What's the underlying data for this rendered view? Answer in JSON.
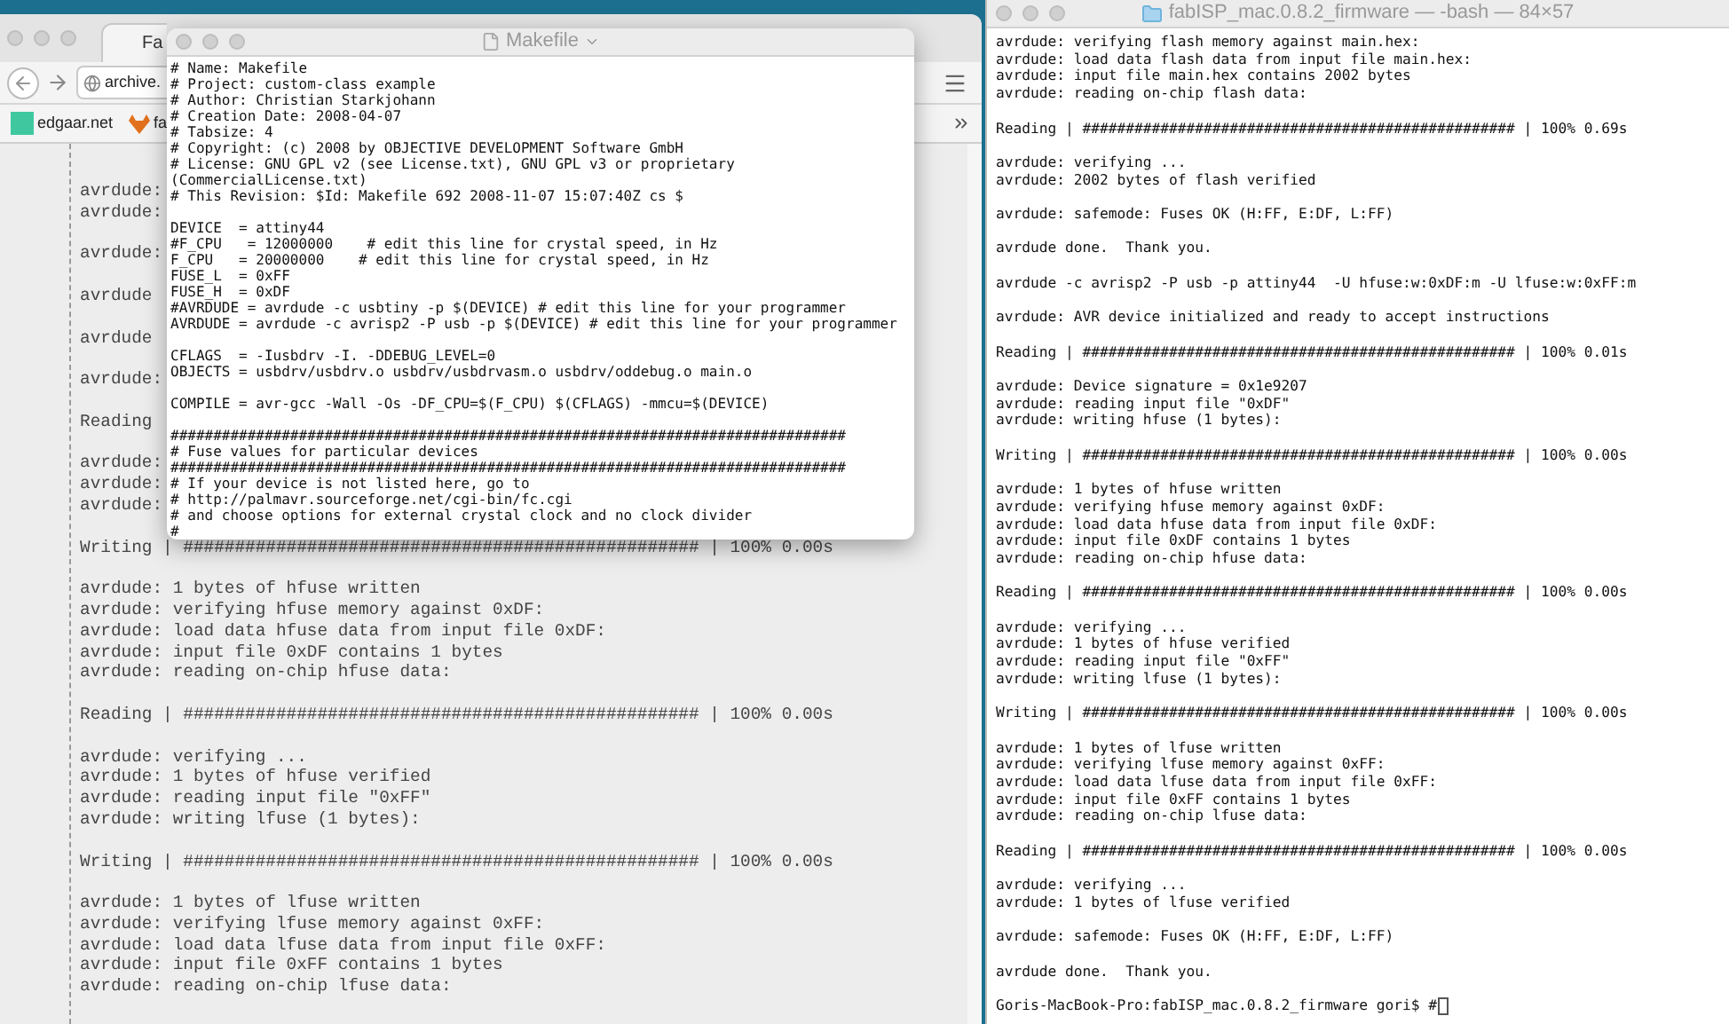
{
  "browser": {
    "tab": {
      "title": "Fa"
    },
    "address_bar": {
      "value": "archive."
    },
    "bookmarks": [
      {
        "label": "edgaar.net",
        "kind": "square"
      },
      {
        "label": "fa",
        "kind": "fox"
      }
    ],
    "page": {
      "output_blocks": [
        [
          "avrdude:",
          "avrdude:"
        ],
        [
          "avrdude:"
        ],
        [
          "avrdude"
        ],
        [
          "avrdude"
        ],
        [
          "avrdude:"
        ],
        [
          "Reading"
        ],
        [
          "avrdude:",
          "avrdude:",
          "avrdude:"
        ],
        [
          "Writing | ################################################## | 100% 0.00s"
        ],
        [
          "avrdude: 1 bytes of hfuse written",
          "avrdude: verifying hfuse memory against 0xDF:",
          "avrdude: load data hfuse data from input file 0xDF:",
          "avrdude: input file 0xDF contains 1 bytes",
          "avrdude: reading on-chip hfuse data:"
        ],
        [
          "Reading | ################################################## | 100% 0.00s"
        ],
        [
          "avrdude: verifying ...",
          "avrdude: 1 bytes of hfuse verified",
          "avrdude: reading input file \"0xFF\"",
          "avrdude: writing lfuse (1 bytes):"
        ],
        [
          "Writing | ################################################## | 100% 0.00s"
        ],
        [
          "avrdude: 1 bytes of lfuse written",
          "avrdude: verifying lfuse memory against 0xFF:",
          "avrdude: load data lfuse data from input file 0xFF:",
          "avrdude: input file 0xFF contains 1 bytes",
          "avrdude: reading on-chip lfuse data:"
        ]
      ]
    }
  },
  "editor": {
    "title": "Makefile",
    "blocks": [
      [
        "# Name: Makefile",
        "# Project: custom-class example",
        "# Author: Christian Starkjohann",
        "# Creation Date: 2008-04-07",
        "# Tabsize: 4",
        "# Copyright: (c) 2008 by OBJECTIVE DEVELOPMENT Software GmbH",
        "# License: GNU GPL v2 (see License.txt), GNU GPL v3 or proprietary",
        "(CommercialLicense.txt)",
        "# This Revision: $Id: Makefile 692 2008-11-07 15:07:40Z cs $"
      ],
      [
        "DEVICE  = attiny44",
        "#F_CPU   = 12000000    # edit this line for crystal speed, in Hz",
        "F_CPU   = 20000000    # edit this line for crystal speed, in Hz",
        "FUSE_L  = 0xFF",
        "FUSE_H  = 0xDF",
        "#AVRDUDE = avrdude -c usbtiny -p $(DEVICE) # edit this line for your programmer",
        "AVRDUDE = avrdude -c avrisp2 -P usb -p $(DEVICE) # edit this line for your programmer"
      ],
      [
        "CFLAGS  = -Iusbdrv -I. -DDEBUG_LEVEL=0",
        "OBJECTS = usbdrv/usbdrv.o usbdrv/usbdrvasm.o usbdrv/oddebug.o main.o"
      ],
      [
        "COMPILE = avr-gcc -Wall -Os -DF_CPU=$(F_CPU) $(CFLAGS) -mmcu=$(DEVICE)"
      ],
      [
        "###############################################################################",
        "# Fuse values for particular devices",
        "###############################################################################",
        "# If your device is not listed here, go to",
        "# http://palmavr.sourceforge.net/cgi-bin/fc.cgi",
        "# and choose options for external crystal clock and no clock divider",
        "#"
      ]
    ]
  },
  "terminal": {
    "title": "fabISP_mac.0.8.2_firmware — -bash — 84×57",
    "blocks": [
      [
        "avrdude: verifying flash memory against main.hex:",
        "avrdude: load data flash data from input file main.hex:",
        "avrdude: input file main.hex contains 2002 bytes",
        "avrdude: reading on-chip flash data:"
      ],
      [
        "Reading | ################################################## | 100% 0.69s"
      ],
      [
        "avrdude: verifying ...",
        "avrdude: 2002 bytes of flash verified"
      ],
      [
        "avrdude: safemode: Fuses OK (H:FF, E:DF, L:FF)"
      ],
      [
        "avrdude done.  Thank you."
      ],
      [
        "avrdude -c avrisp2 -P usb -p attiny44  -U hfuse:w:0xDF:m -U lfuse:w:0xFF:m"
      ],
      [
        "avrdude: AVR device initialized and ready to accept instructions"
      ],
      [
        "Reading | ################################################## | 100% 0.01s"
      ],
      [
        "avrdude: Device signature = 0x1e9207",
        "avrdude: reading input file \"0xDF\"",
        "avrdude: writing hfuse (1 bytes):"
      ],
      [
        "Writing | ################################################## | 100% 0.00s"
      ],
      [
        "avrdude: 1 bytes of hfuse written",
        "avrdude: verifying hfuse memory against 0xDF:",
        "avrdude: load data hfuse data from input file 0xDF:",
        "avrdude: input file 0xDF contains 1 bytes",
        "avrdude: reading on-chip hfuse data:"
      ],
      [
        "Reading | ################################################## | 100% 0.00s"
      ],
      [
        "avrdude: verifying ...",
        "avrdude: 1 bytes of hfuse verified",
        "avrdude: reading input file \"0xFF\"",
        "avrdude: writing lfuse (1 bytes):"
      ],
      [
        "Writing | ################################################## | 100% 0.00s"
      ],
      [
        "avrdude: 1 bytes of lfuse written",
        "avrdude: verifying lfuse memory against 0xFF:",
        "avrdude: load data lfuse data from input file 0xFF:",
        "avrdude: input file 0xFF contains 1 bytes",
        "avrdude: reading on-chip lfuse data:"
      ],
      [
        "Reading | ################################################## | 100% 0.00s"
      ],
      [
        "avrdude: verifying ...",
        "avrdude: 1 bytes of lfuse verified"
      ],
      [
        "avrdude: safemode: Fuses OK (H:FF, E:DF, L:FF)"
      ],
      [
        "avrdude done.  Thank you."
      ]
    ],
    "prompt": "Goris-MacBook-Pro:fabISP_mac.0.8.2_firmware gori$ #"
  }
}
